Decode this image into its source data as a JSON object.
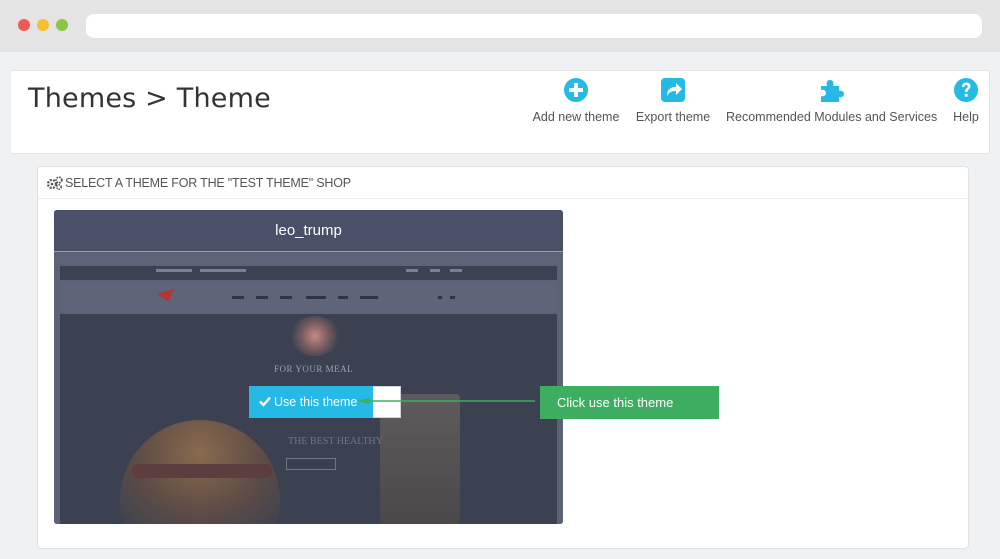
{
  "browser": {
    "controls": [
      "close",
      "minimize",
      "maximize"
    ]
  },
  "header": {
    "title": "Themes > Theme",
    "toolbar": {
      "add_new_theme": {
        "label": "Add new theme",
        "icon": "plus-circle-icon"
      },
      "export_theme": {
        "label": "Export theme",
        "icon": "share-arrow-icon"
      },
      "recommended": {
        "label": "Recommended Modules and Services",
        "icon": "puzzle-icon"
      },
      "help": {
        "label": "Help",
        "icon": "question-circle-icon"
      }
    },
    "icon_color": "#25b9e6"
  },
  "panel": {
    "heading": "SELECT A THEME FOR THE \"TEST THEME\" SHOP",
    "heading_icon": "gears-icon"
  },
  "theme_card": {
    "name": "leo_trump",
    "preview_text": "FOR YOUR MEAL",
    "preview_text2": "THE BEST HEALTHY",
    "use_button_label": "Use this theme",
    "use_button_icon": "check-icon",
    "button_color": "#25b9e6"
  },
  "annotation": {
    "text": "Click use this theme",
    "color": "#3dae5f"
  }
}
